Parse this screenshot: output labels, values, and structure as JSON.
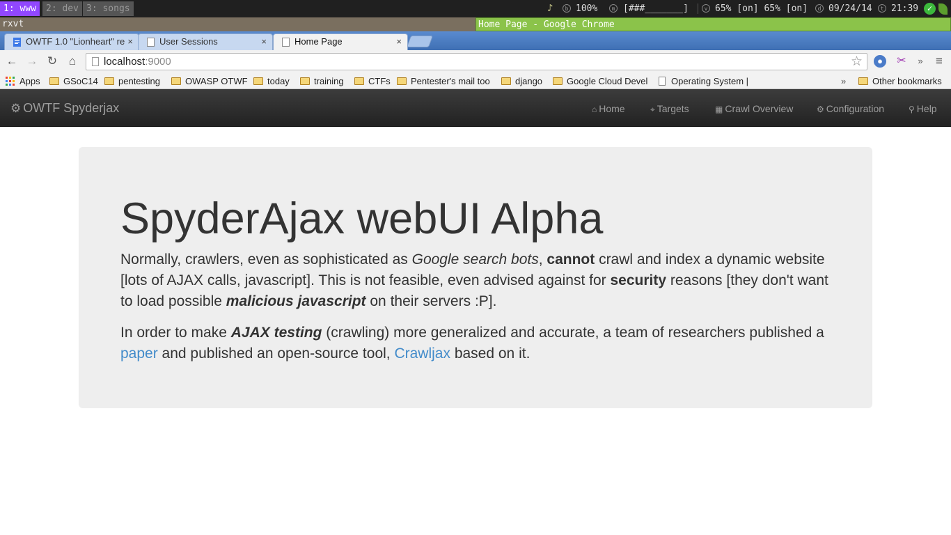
{
  "i3bar": {
    "workspaces": [
      "1: www",
      "2: dev",
      "3: songs"
    ],
    "volume": "100%",
    "memory": "[###_______]",
    "vpn": "65% [on] 65% [on]",
    "date": "09/24/14",
    "time": "21:39"
  },
  "windows": {
    "left_title": "rxvt",
    "right_title": "Home Page - Google Chrome"
  },
  "tabs": [
    {
      "label": "OWTF 1.0 \"Lionheart\" re",
      "close": "×"
    },
    {
      "label": "User Sessions",
      "close": "×"
    },
    {
      "label": "Home Page",
      "close": "×"
    }
  ],
  "omnibox": {
    "host": "localhost",
    "port": ":9000"
  },
  "bookmarks": {
    "items": [
      "Apps",
      "GSoC14",
      "pentesting",
      "OWASP OTWF",
      "today",
      "training",
      "CTFs",
      "Pentester's mail too",
      "django",
      "Google Cloud Devel",
      "Operating System | "
    ],
    "overflow": "»",
    "other": "Other bookmarks"
  },
  "navbar": {
    "brand": "OWTF Spyderjax",
    "links": [
      "Home",
      "Targets",
      "Crawl Overview",
      "Configuration",
      "Help"
    ]
  },
  "jumbotron": {
    "title": "SpyderAjax webUI Alpha",
    "p1": {
      "t1": "Normally, crawlers, even as sophisticated as ",
      "em1": "Google search bots",
      "t2": ", ",
      "b1": "cannot",
      "t3": " crawl and index a dynamic website [lots of AJAX calls, javascript]. This is not feasible, even advised against for ",
      "b2": "security",
      "t4": " reasons [they don't want to load possible ",
      "bi1": "malicious javascript",
      "t5": " on their servers :P]."
    },
    "p2": {
      "t1": "In order to make ",
      "bi1": "AJAX testing",
      "t2": " (crawling) more generalized and accurate, a team of researchers published a ",
      "link1": "paper",
      "t3": " and published an open-source tool, ",
      "link2": "Crawljax",
      "t4": " based on it."
    },
    "link_color": "#428bca"
  }
}
